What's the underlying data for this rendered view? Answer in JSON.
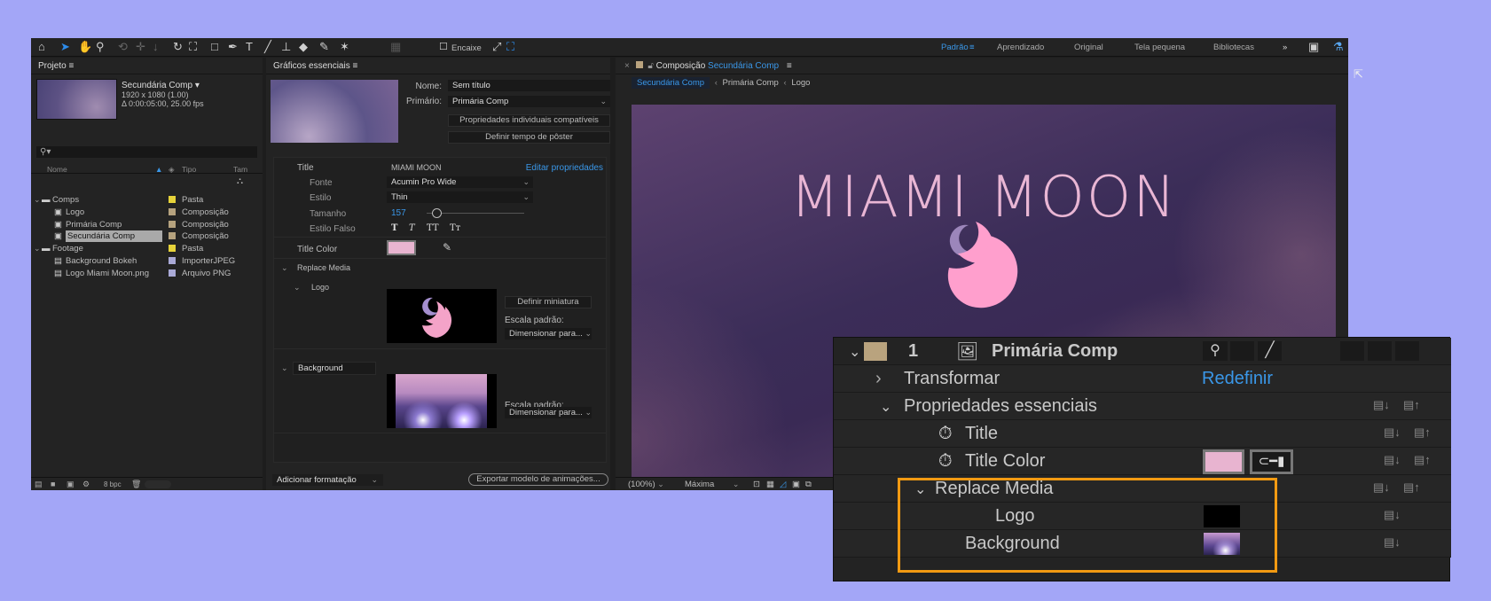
{
  "toolbar": {
    "snap_label": "Encaixe",
    "workspaces": [
      "Padrão",
      "Aprendizado",
      "Original",
      "Tela pequena",
      "Bibliotecas"
    ],
    "more": "»"
  },
  "project": {
    "title": "Projeto",
    "selected_name": "Secundária Comp",
    "selected_dims": "1920 x 1080 (1.00)",
    "selected_duration": "Δ 0:00:05:00, 25.00 fps",
    "columns": {
      "name": "Nome",
      "type": "Tipo",
      "size": "Tam"
    },
    "items": [
      {
        "name": "Comps",
        "type": "Pasta",
        "color": "#e6d33a",
        "kind": "folder",
        "indent": 0
      },
      {
        "name": "Logo",
        "type": "Composição",
        "color": "#b5a27e",
        "kind": "comp",
        "indent": 1
      },
      {
        "name": "Primária Comp",
        "type": "Composição",
        "color": "#b5a27e",
        "kind": "comp",
        "indent": 1
      },
      {
        "name": "Secundária Comp",
        "type": "Composição",
        "color": "#b5a27e",
        "kind": "comp",
        "indent": 1
      },
      {
        "name": "Footage",
        "type": "Pasta",
        "color": "#e6d33a",
        "kind": "folder",
        "indent": 0
      },
      {
        "name": "Background Bokeh",
        "type": "ImporterJPEG",
        "color": "#a9a9d6",
        "kind": "file",
        "indent": 1
      },
      {
        "name": "Logo Miami Moon.png",
        "type": "Arquivo PNG",
        "color": "#a9a9d6",
        "kind": "file",
        "indent": 1
      }
    ],
    "bpc": "8 bpc"
  },
  "graphics": {
    "title": "Gráficos essenciais",
    "name_label": "Nome:",
    "name_value": "Sem título",
    "primary_label": "Primário:",
    "primary_value": "Primária Comp",
    "btn_compat": "Propriedades individuais compatíveis",
    "btn_poster": "Definir tempo de pôster",
    "title_label": "Title",
    "title_value": "MIAMI MOON",
    "edit_props": "Editar propriedades",
    "font_label": "Fonte",
    "font_value": "Acumin Pro Wide",
    "style_label": "Estilo",
    "style_value": "Thin",
    "size_label": "Tamanho",
    "size_value": "157",
    "size_fraction": 0.1,
    "faux_label": "Estilo Falso",
    "faux": [
      "T",
      "T",
      "TT",
      "Tт"
    ],
    "title_color_label": "Title Color",
    "title_color": "#e8b4d0",
    "replace_media": "Replace Media",
    "logo_label": "Logo",
    "set_thumb": "Definir miniatura",
    "scale_label": "Escala padrão:",
    "scale_value": "Dimensionar para...",
    "background_label": "Background",
    "add_format": "Adicionar formatação",
    "export": "Exportar modelo de animações..."
  },
  "comp": {
    "tab_prefix": "Composição",
    "tab_name": "Secundária Comp",
    "breadcrumbs": [
      "Secundária Comp",
      "Primária Comp",
      "Logo"
    ],
    "viewer_title": "MIAMI MOON",
    "zoom": "(100%)",
    "resolution": "Máxima"
  },
  "timeline": {
    "layer_number": "1",
    "layer_name": "Primária Comp",
    "transform": "Transformar",
    "reset": "Redefinir",
    "essential": "Propriedades essenciais",
    "title": "Title",
    "title_color": "Title Color",
    "replace_media": "Replace Media",
    "logo": "Logo",
    "background": "Background",
    "label_color": "#b9a37e",
    "highlight_color": "#f29a12"
  }
}
